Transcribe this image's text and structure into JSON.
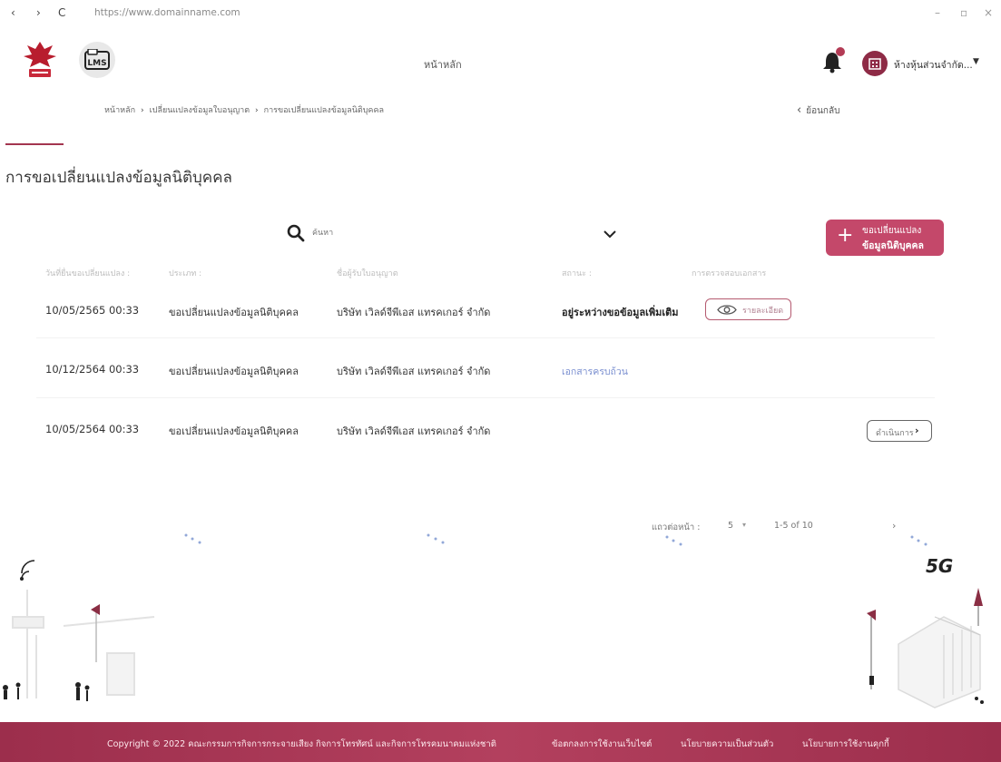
{
  "browser": {
    "url": "https://www.domainname.com"
  },
  "header": {
    "title": "หน้าหลัก",
    "lms_logo_text": "LMS",
    "company_name": "ห้างหุ้นส่วนจำกัด..."
  },
  "breadcrumb": {
    "items": [
      "หน้าหลัก",
      "เปลี่ยนแปลงข้อมูลใบอนุญาต",
      "การขอเปลี่ยนแปลงข้อมูลนิติบุคคล"
    ],
    "back_label": "ย้อนกลับ"
  },
  "page": {
    "title": "การขอเปลี่ยนแปลงข้อมูลนิติบุคคล"
  },
  "search": {
    "placeholder": "ค้นหา"
  },
  "add_button": {
    "line1": "ขอเปลี่ยนแปลง",
    "line2": "ข้อมูลนิติบุคคล"
  },
  "table": {
    "headers": [
      "วันที่ยื่นขอเปลี่ยนแปลง :",
      "ประเภท :",
      "ชื่อผู้รับใบอนุญาต",
      "สถานะ :",
      "การตรวจสอบเอกสาร"
    ],
    "rows": [
      {
        "date": "10/05/2565  00:33",
        "type": "ขอเปลี่ยนแปลงข้อมูลนิติบุคคล",
        "licensee": "บริษัท เวิลด์จีพีเอส แทรคเกอร์ จำกัด",
        "status": "อยู่ระหว่างขอข้อมูลเพิ่มเติม",
        "action": "รายละเอียด"
      },
      {
        "date": "10/12/2564  00:33",
        "type": "ขอเปลี่ยนแปลงข้อมูลนิติบุคคล",
        "licensee": "บริษัท เวิลด์จีพีเอส แทรคเกอร์ จำกัด",
        "status": "เอกสารครบถ้วน",
        "action": ""
      },
      {
        "date": "10/05/2564  00:33",
        "type": "ขอเปลี่ยนแปลงข้อมูลนิติบุคคล",
        "licensee": "บริษัท เวิลด์จีพีเอส แทรคเกอร์ จำกัด",
        "status": "",
        "action": "ดำเนินการ"
      }
    ]
  },
  "pagination": {
    "rows_per_page_label": "แถวต่อหน้า :",
    "rows_per_page": "5",
    "range": "1-5 of 10"
  },
  "background": {
    "network_label": "5G"
  },
  "footer": {
    "copyright": "Copyright © 2022 คณะกรรมการกิจการกระจายเสียง กิจการโทรทัศน์ และกิจการโทรคมนาคมแห่งชาติ",
    "links": [
      "ข้อตกลงการใช้งานเว็บไซต์",
      "นโยบายความเป็นส่วนตัว",
      "นโยบายการใช้งานคุกกี้"
    ]
  },
  "colors": {
    "brand": "#a3354f",
    "button": "#c4486a",
    "footer": "#9c2e4c",
    "status_link": "#7a8fd0"
  },
  "icons": [
    "back-nav-icon",
    "forward-nav-icon",
    "reload-icon",
    "garuda-emblem",
    "lms-logo",
    "bell-icon",
    "building-avatar-icon",
    "chevron-down-icon",
    "chevron-left-icon",
    "search-icon",
    "plus-icon",
    "eye-icon",
    "chevron-right-icon"
  ]
}
